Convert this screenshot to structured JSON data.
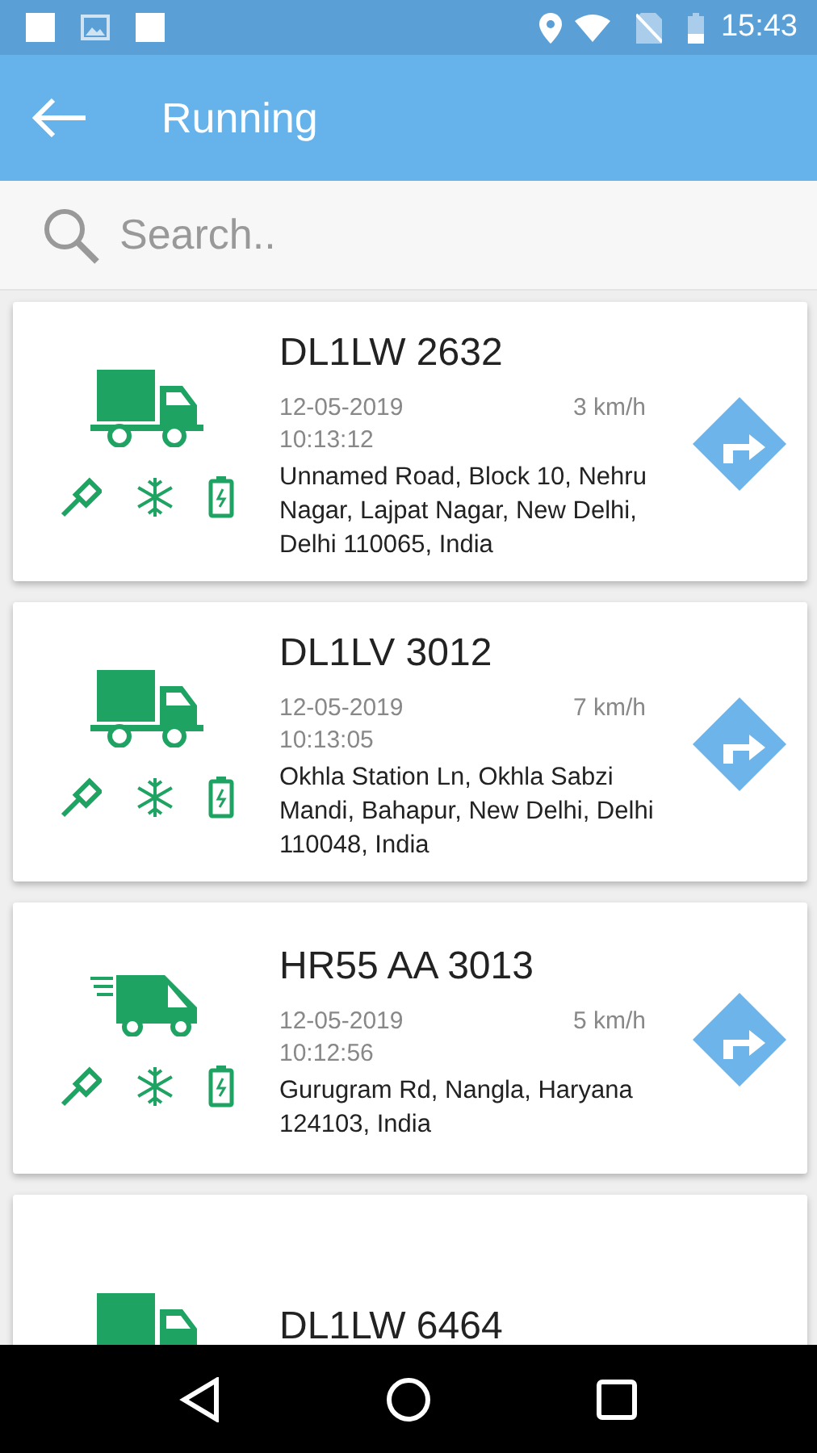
{
  "status_bar": {
    "time": "15:43"
  },
  "app_bar": {
    "title": "Running"
  },
  "search": {
    "placeholder": "Search.."
  },
  "vehicles": [
    {
      "kind": "truck",
      "plate": "DL1LW 2632",
      "date": "12-05-2019",
      "time": "10:13:12",
      "speed": "3 km/h",
      "address": "Unnamed Road, Block 10, Nehru Nagar, Lajpat Nagar, New Delhi, Delhi 110065, India"
    },
    {
      "kind": "truck",
      "plate": "DL1LV 3012",
      "date": "12-05-2019",
      "time": "10:13:05",
      "speed": "7 km/h",
      "address": "Okhla Station Ln, Okhla Sabzi Mandi, Bahapur, New Delhi, Delhi 110048, India"
    },
    {
      "kind": "van",
      "plate": "HR55 AA 3013",
      "date": "12-05-2019",
      "time": "10:12:56",
      "speed": "5 km/h",
      "address": "Gurugram Rd, Nangla, Haryana 124103, India"
    },
    {
      "kind": "truck",
      "plate": "DL1LW 6464"
    }
  ]
}
